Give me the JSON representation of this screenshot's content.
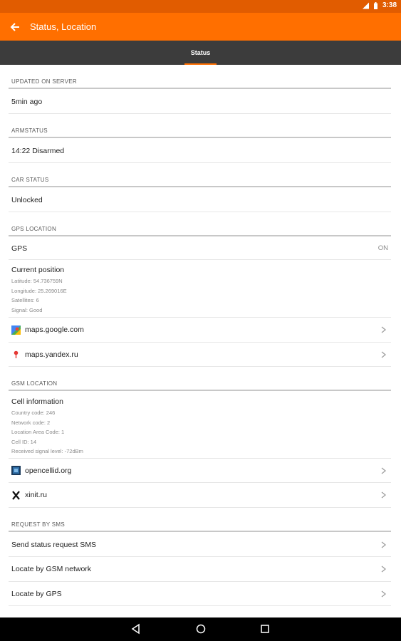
{
  "statusbar": {
    "time": "3:38"
  },
  "appbar": {
    "title": "Status, Location"
  },
  "tabs": [
    {
      "label": "Status"
    }
  ],
  "sections": {
    "updated": {
      "header": "UPDATED ON SERVER",
      "value": "5min ago"
    },
    "arm": {
      "header": "ARMSTATUS",
      "value": "14:22 Disarmed"
    },
    "car": {
      "header": "CAR STATUS",
      "value": "Unlocked"
    },
    "gps": {
      "header": "GPS LOCATION",
      "gps_label": "GPS",
      "gps_value": "ON",
      "position_title": "Current position",
      "position_lines": [
        "Latitude: 54.736759N",
        "Longitude: 25.269016E",
        "Satellites: 6",
        "Signal: Good"
      ],
      "links": [
        {
          "label": "maps.google.com",
          "icon": "google-maps-icon"
        },
        {
          "label": "maps.yandex.ru",
          "icon": "yandex-maps-icon"
        }
      ]
    },
    "gsm": {
      "header": "GSM LOCATION",
      "cell_title": "Cell information",
      "cell_lines": [
        "Country code: 246",
        "Network code: 2",
        "Location Area Code: 1",
        "Cell ID: 14",
        "Received signal level: -72dBm"
      ],
      "links": [
        {
          "label": "opencellid.org",
          "icon": "opencellid-icon"
        },
        {
          "label": "xinit.ru",
          "icon": "xinit-icon"
        }
      ]
    },
    "sms": {
      "header": "REQUEST BY SMS",
      "items": [
        {
          "label": "Send status request SMS"
        },
        {
          "label": "Locate by GSM network"
        },
        {
          "label": "Locate by GPS"
        }
      ]
    }
  },
  "colors": {
    "appbar": "#ff6f00",
    "statusbar": "#e15c00",
    "tabbar": "#3c3c3c"
  }
}
